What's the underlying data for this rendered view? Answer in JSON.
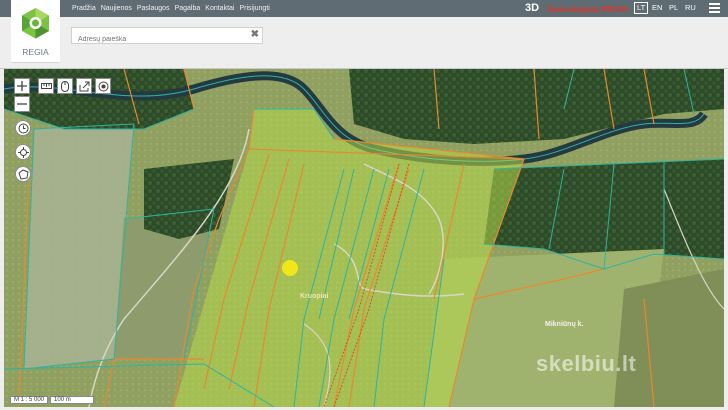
{
  "header": {
    "nav": [
      "Pradžia",
      "Naujienos",
      "Paslaugos",
      "Pagalba",
      "Kontaktai",
      "Prisijungti"
    ],
    "btn3d": "3D",
    "brand": "Savivaldybių REGIA",
    "languages": [
      "LT",
      "EN",
      "PL",
      "RU"
    ],
    "active_language": "LT"
  },
  "logo": {
    "text": "REGIA"
  },
  "search": {
    "placeholder": "Adresų paieška",
    "value": ""
  },
  "map": {
    "place_labels": [
      "Kruopiai",
      "Mikniūnų k."
    ],
    "scale_ratio": "M 1 : 5 000",
    "scale_length": "100 m",
    "watermark": "skelbiu.lt",
    "watermark_sub": "skelbiu.lt"
  },
  "colors": {
    "parcel_orange": "#e8892e",
    "parcel_teal": "#2fb3a0",
    "highlight": "#b6d84a",
    "marker": "#f2e51a",
    "brand_red": "#d9372b"
  },
  "icons": [
    "zoom-in-icon",
    "zoom-out-icon",
    "ruler-icon",
    "mouse-icon",
    "share-icon",
    "locate-icon",
    "clock-icon",
    "crosshair-icon",
    "polygon-icon",
    "menu-icon",
    "clear-icon",
    "regia-logo-icon"
  ]
}
